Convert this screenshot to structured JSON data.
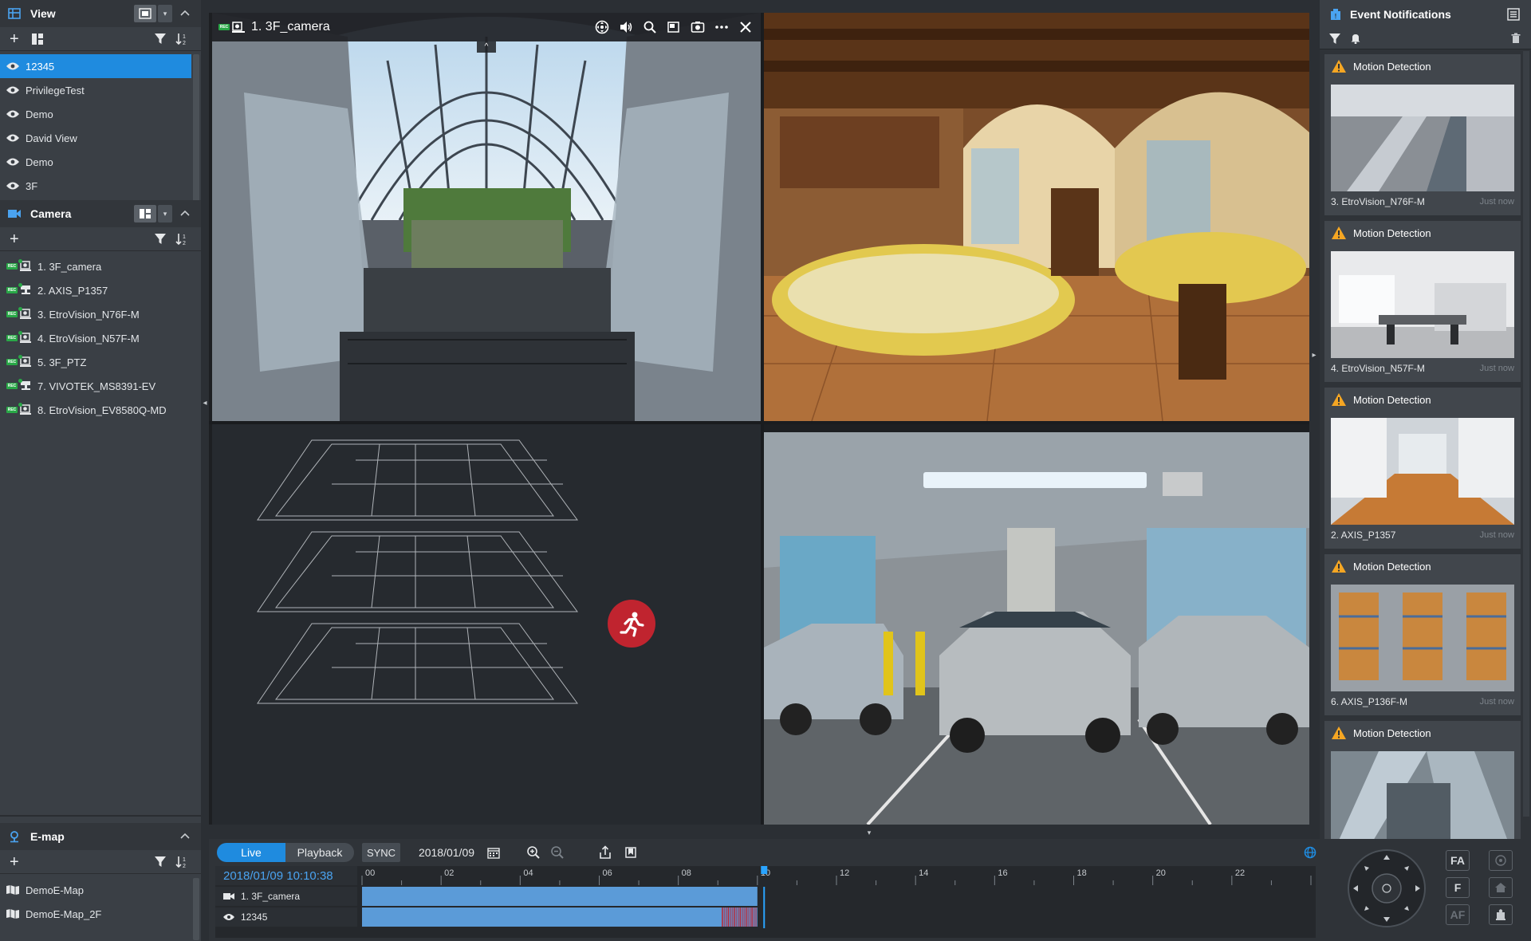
{
  "left_panel": {
    "view_section": {
      "title": "View",
      "items": [
        "12345",
        "PrivilegeTest",
        "Demo",
        "David View",
        "Demo",
        "3F"
      ],
      "selected_index": 0
    },
    "camera_section": {
      "title": "Camera",
      "rec_badge": "REC",
      "items": [
        "1. 3F_camera",
        "2. AXIS_P1357",
        "3. EtroVision_N76F-M",
        "4. EtroVision_N57F-M",
        "5. 3F_PTZ",
        "7. VIVOTEK_MS8391-EV",
        "8. EtroVision_EV8580Q-MD"
      ]
    },
    "emap_section": {
      "title": "E-map",
      "items": [
        "DemoE-Map",
        "DemoE-Map_2F"
      ]
    }
  },
  "video_grid": {
    "active_tile": {
      "rec_badge": "REC",
      "title": "1. 3F_camera",
      "toolbar_icons": [
        "ptz-icon",
        "speaker-icon",
        "zoom-icon",
        "pip-icon",
        "snapshot-icon",
        "more-icon",
        "close-icon"
      ]
    },
    "tiles": [
      {
        "name": "atrium-camera",
        "scene": "glass atrium with escalators"
      },
      {
        "name": "restaurant-camera",
        "scene": "restaurant dining room"
      },
      {
        "name": "emap-view",
        "scene": "3-floor building map with motion alert"
      },
      {
        "name": "parking-camera",
        "scene": "underground parking garage"
      }
    ]
  },
  "timeline": {
    "live_label": "Live",
    "playback_label": "Playback",
    "sync_label": "SYNC",
    "date": "2018/01/09",
    "timestamp": "2018/01/09 10:10:38",
    "hours": [
      "00",
      "02",
      "04",
      "06",
      "08",
      "10",
      "12",
      "14",
      "16",
      "18",
      "20",
      "22"
    ],
    "rows": [
      {
        "label": "1. 3F_camera",
        "recorded_until_hour": 10
      },
      {
        "label": "12345",
        "recorded_until_hour": 10
      }
    ],
    "cursor_hour": 10.17
  },
  "event_panel": {
    "title": "Event Notifications",
    "events": [
      {
        "type": "Motion Detection",
        "camera": "3. EtroVision_N76F-M",
        "time": "Just now"
      },
      {
        "type": "Motion Detection",
        "camera": "4. EtroVision_N57F-M",
        "time": "Just now"
      },
      {
        "type": "Motion Detection",
        "camera": "2. AXIS_P1357",
        "time": "Just now"
      },
      {
        "type": "Motion Detection",
        "camera": "6. AXIS_P136F-M",
        "time": "Just now"
      },
      {
        "type": "Motion Detection",
        "camera": "",
        "time": ""
      }
    ]
  },
  "ptz_panel": {
    "focus_auto_label": "FA",
    "focus_label": "F",
    "af_label": "AF"
  },
  "colors": {
    "accent": "#1f8bdf",
    "rec_green": "#29a847",
    "warning": "#f5a623",
    "motion_red": "#c0242f"
  }
}
